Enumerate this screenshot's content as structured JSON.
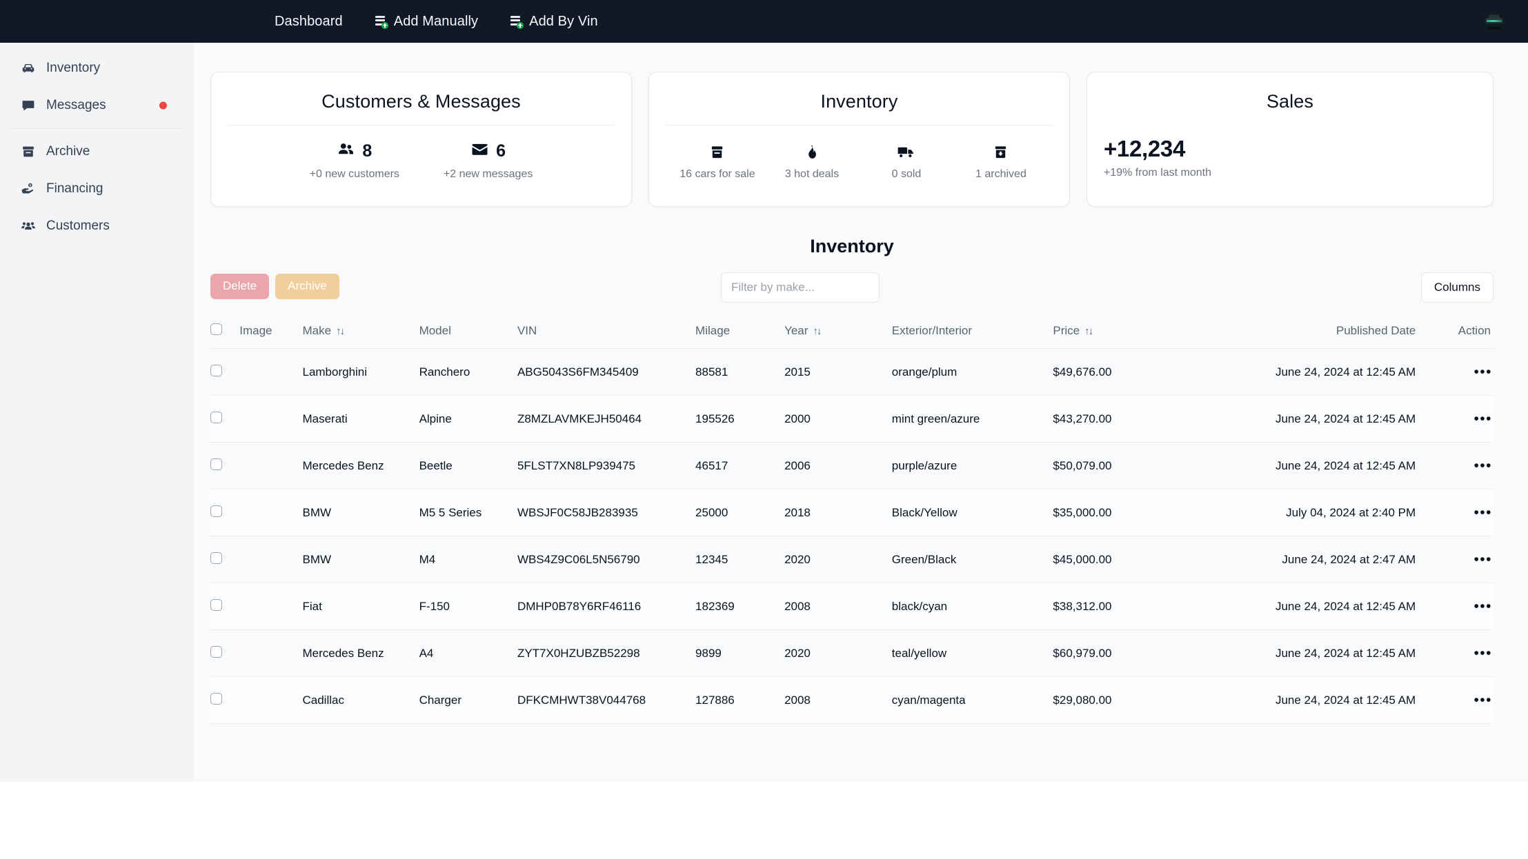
{
  "topnav": {
    "links": [
      {
        "label": "Dashboard",
        "icon": ""
      },
      {
        "label": "Add Manually",
        "icon": "database-plus-icon"
      },
      {
        "label": "Add By Vin",
        "icon": "database-plus-icon"
      }
    ],
    "avatar_icon": "car-avatar",
    "background": "#111827"
  },
  "sidebar": {
    "items": [
      {
        "label": "Inventory",
        "icon": "car-icon",
        "badge": false
      },
      {
        "label": "Messages",
        "icon": "chat-bubble-icon",
        "badge": true
      },
      {
        "label": "Archive",
        "icon": "archive-box-icon",
        "badge": false
      },
      {
        "label": "Financing",
        "icon": "hand-dollar-icon",
        "badge": false
      },
      {
        "label": "Customers",
        "icon": "people-icon",
        "badge": false
      }
    ],
    "badge_color": "#ef4444"
  },
  "cards": {
    "customers": {
      "title": "Customers & Messages",
      "stats": [
        {
          "icon": "people-icon",
          "value": "8",
          "sub": "+0 new customers"
        },
        {
          "icon": "envelope-icon",
          "value": "6",
          "sub": "+2 new messages"
        }
      ]
    },
    "inventory": {
      "title": "Inventory",
      "stats": [
        {
          "icon": "box-icon",
          "sub": "16 cars for sale"
        },
        {
          "icon": "flame-icon",
          "sub": "3 hot deals"
        },
        {
          "icon": "truck-icon",
          "sub": "0 sold"
        },
        {
          "icon": "archive-down-icon",
          "sub": "1 archived"
        }
      ]
    },
    "sales": {
      "title": "Sales",
      "value": "+12,234",
      "sub": "+19% from last month"
    }
  },
  "inventory_section": {
    "heading": "Inventory",
    "delete_label": "Delete",
    "archive_label": "Archive",
    "filter_placeholder": "Filter by make...",
    "filter_value": "",
    "columns_label": "Columns",
    "delete_color": "#eaa6ab",
    "archive_color": "#f2ce9c"
  },
  "table": {
    "headers": [
      {
        "label": "",
        "sortable": false
      },
      {
        "label": "Image",
        "sortable": false
      },
      {
        "label": "Make",
        "sortable": true
      },
      {
        "label": "Model",
        "sortable": false
      },
      {
        "label": "VIN",
        "sortable": false
      },
      {
        "label": "Milage",
        "sortable": false
      },
      {
        "label": "Year",
        "sortable": true
      },
      {
        "label": "Exterior/Interior",
        "sortable": false
      },
      {
        "label": "Price",
        "sortable": true
      },
      {
        "label": "Published Date",
        "sortable": false
      },
      {
        "label": "Action",
        "sortable": false
      }
    ],
    "sort_glyph": "↑↓",
    "action_glyph": "•••",
    "rows": [
      {
        "make": "Lamborghini",
        "model": "Ranchero",
        "vin": "ABG5043S6FM345409",
        "milage": "88581",
        "year": "2015",
        "exterior_interior": "orange/plum",
        "price": "$49,676.00",
        "published": "June 24, 2024 at 12:45 AM",
        "thumb": {
          "body": "#d9d9d9",
          "accent": "#3b3b3b",
          "bg": "#4a4a4a"
        }
      },
      {
        "make": "Maserati",
        "model": "Alpine",
        "vin": "Z8MZLAVMKEJH50464",
        "milage": "195526",
        "year": "2000",
        "exterior_interior": "mint green/azure",
        "price": "$43,270.00",
        "published": "June 24, 2024 at 12:45 AM",
        "thumb": {
          "body": "#8ea7b3",
          "accent": "#2d3f4a",
          "bg": "#6f8490"
        }
      },
      {
        "make": "Mercedes Benz",
        "model": "Beetle",
        "vin": "5FLST7XN8LP939475",
        "milage": "46517",
        "year": "2006",
        "exterior_interior": "purple/azure",
        "price": "$50,079.00",
        "published": "June 24, 2024 at 12:45 AM",
        "thumb": {
          "body": "#6d7c5c",
          "accent": "#3c4733",
          "bg": "#55604a"
        }
      },
      {
        "make": "BMW",
        "model": "M5 5 Series",
        "vin": "WBSJF0C58JB283935",
        "milage": "25000",
        "year": "2018",
        "exterior_interior": "Black/Yellow",
        "price": "$35,000.00",
        "published": "July 04, 2024 at 2:40 PM",
        "thumb": {
          "body": "#20262b",
          "accent": "#c9d14a",
          "bg": "#15191d"
        }
      },
      {
        "make": "BMW",
        "model": "M4",
        "vin": "WBS4Z9C06L5N56790",
        "milage": "12345",
        "year": "2020",
        "exterior_interior": "Green/Black",
        "price": "$45,000.00",
        "published": "June 24, 2024 at 2:47 AM",
        "thumb": {
          "body": "#c8d930",
          "accent": "#2b2f22",
          "bg": "#8a8f7a"
        }
      },
      {
        "make": "Fiat",
        "model": "F-150",
        "vin": "DMHP0B78Y6RF46116",
        "milage": "182369",
        "year": "2008",
        "exterior_interior": "black/cyan",
        "price": "$38,312.00",
        "published": "June 24, 2024 at 12:45 AM",
        "thumb": {
          "body": "#f5b81a",
          "accent": "#e07a1c",
          "bg": "#dfe3e6"
        }
      },
      {
        "make": "Mercedes Benz",
        "model": "A4",
        "vin": "ZYT7X0HZUBZB52298",
        "milage": "9899",
        "year": "2020",
        "exterior_interior": "teal/yellow",
        "price": "$60,979.00",
        "published": "June 24, 2024 at 12:45 AM",
        "thumb": {
          "body": "#c4601f",
          "accent": "#efe2d2",
          "bg": "#9e5526"
        }
      },
      {
        "make": "Cadillac",
        "model": "Charger",
        "vin": "DFKCMHWT38V044768",
        "milage": "127886",
        "year": "2008",
        "exterior_interior": "cyan/magenta",
        "price": "$29,080.00",
        "published": "June 24, 2024 at 12:45 AM",
        "thumb": {
          "body": "#a9b0b5",
          "accent": "#1c1f22",
          "bg": "#7d858b"
        }
      }
    ]
  }
}
